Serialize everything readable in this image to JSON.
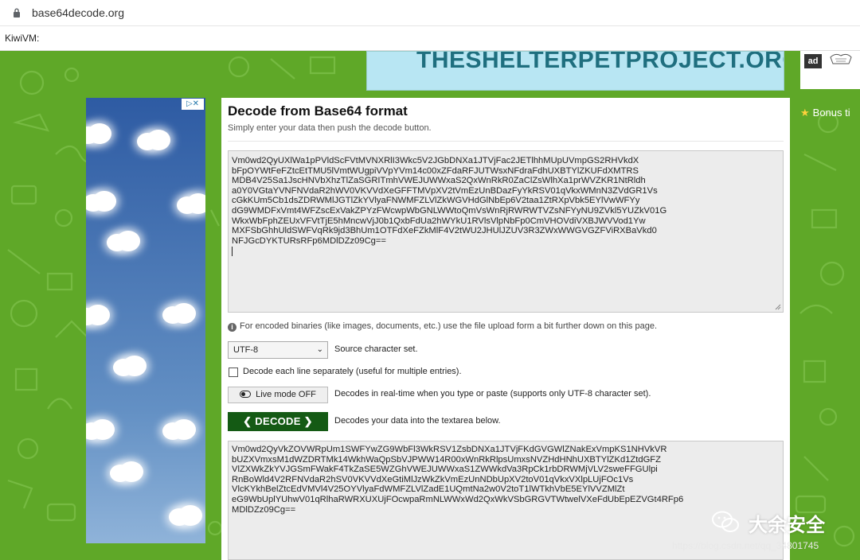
{
  "browser": {
    "url": "base64decode.org",
    "bookmark": "KiwiVM:"
  },
  "ads": {
    "banner_text": "THESHELTERPETPROJECT.ORG",
    "ad_logo": "ad",
    "sidebar_ad_choice": "▷✕"
  },
  "main": {
    "title": "Decode from Base64 format",
    "subtitle": "Simply enter your data then push the decode button.",
    "input_text": "Vm0wd2QyUXlWa1pPVldScFVtMVNXRlI3Wkc5V2JGbDNXa1JTVjFac2JETlhhMUpUVmpGS2RHVkdX\nbFpOYWtFeFZtcEtTMU5lVmtWUgpiVVpYVm14c00xZFdaRFJUTWsxNFdraFdhUXBTYlZKUFdXMTRS\nMDB4V25Sa1JscHNVbXhzTlZaSGRITmhVWEJUWWxaS2QxWnRkR0ZaClZsWlhXa1prWVZKR1NtRldh\na0Y0VGtaYVNFNVdaR2hWV0VKVVdXeGFFTMVpXV2tVmEzUnBDazFyYkRSV01qVkxWMnN3ZVdGR1Vs\ncGkKUm5Cb1dsZDRWMlJGTlZkYVlyaFNWMFZLVlZkWGVHdGlNbEp6V2taa1ZtRXpVbk5EYlVwWFYy\ndG9WMDFxVmt4WFZscExVakZPYzFWcwpWbGNLWWtoQmVsWnRjRWRWTVZsNFYyNU9ZVkl5YUZkV01G\nWkxWbFphZEUxVFVtTjE5hMncwVjJ0b1QxbFdUa2hWYkU1RVlsVlpNbFp0CmVHOVdiVXBJWVVod1Yw\nMXFSbGhhUldSWFVqRk9jd3BhUm1OTFdXeFZkMlF4V2tWU2JHUlJZUV3R3ZWxWWGVGZFViRXBaVkd0\nNFJGcDYKTURsRFp6MDlDZz09Cg==",
    "info_note": "For encoded binaries (like images, documents, etc.) use the file upload form a bit further down on this page.",
    "charset_value": "UTF-8",
    "charset_label": "Source character set.",
    "line_checkbox_label": "Decode each line separately (useful for multiple entries).",
    "live_mode_button": "Live mode OFF",
    "live_mode_desc": "Decodes in real-time when you type or paste (supports only UTF-8 character set).",
    "decode_button": "DECODE",
    "decode_desc": "Decodes your data into the textarea below.",
    "output_text": "Vm0wd2QyVkZOVWRpUm1SWFYwZG9WbFl3WkRSV1ZsbDNXa1JTVjFKdGVGWlZNakExVmpKS1NHVkVR\nbUZXVmxsM1dWZDRTMk14WkhWaQpSbVJPWW14R00xWnRkRlpsUmxsNVZHdHNhUXBTYlZKd1ZtdGFZ\nVlZXWkZkYVJGSmFWakF4TkZaSE5WZGhVWEJUWWxaS1ZWWkdVa3RpCk1rbDRWMjVLV2sweFFGUlpi\nRnBoWld4V2RFNVdaR2hSV0VKVVdXeGtiMlJzWkZkVmEzUnNDbUpXV2toV01qVkxVXlpLUjFOc1Vs\nVlcKYkhBelZtcEdVMVl4V25OYVlyaFdWMFZLVlZadE1UQmtNa2w0V2toT1lWTkhVbE5EYlVVZMlZt\neG9WbUplYUhwV01qRlhaRWRXUXUjFOcwpaRmNLWWxWd2QxWkVSbGRGVTWtwelVXeFdUbEpEZVGt4RFp6\nMDlDZz09Cg=="
  },
  "sidebar": {
    "bonus": "Bonus ti"
  },
  "watermark": {
    "brand": "大余安全",
    "url": "https://blog.csdn.net/qq_34801745"
  }
}
